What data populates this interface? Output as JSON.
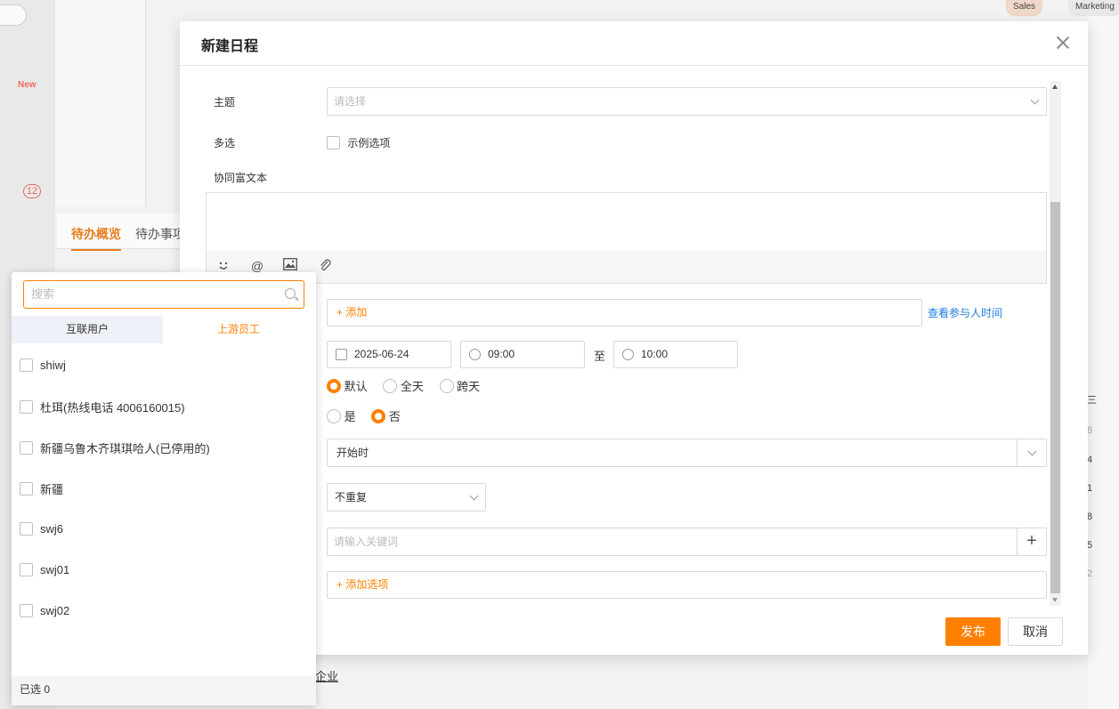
{
  "background": {
    "new_badge": "New",
    "count_badge": "12",
    "tab_active": "待办概览",
    "tab_other": "待办事项",
    "top_right_a": "Sales",
    "top_right_b": "Marketing",
    "enterprise_link": "企业",
    "side_numbers": [
      "三",
      "8",
      "4",
      "1",
      "8",
      "5",
      "2"
    ]
  },
  "modal": {
    "title": "新建日程",
    "subject": {
      "label": "主题",
      "placeholder": "请选择"
    },
    "multi": {
      "label": "多选",
      "option": "示例选项"
    },
    "richtext": {
      "label": "协同富文本"
    },
    "participants": {
      "add": "+ 添加",
      "view_time": "查看参与人时间"
    },
    "date": "2025-06-24",
    "start_time": "09:00",
    "to": "至",
    "end_time": "10:00",
    "day_options": [
      "默认",
      "全天",
      "跨天"
    ],
    "day_selected": 0,
    "yes_no": [
      "是",
      "否"
    ],
    "yes_no_selected": 1,
    "remind_select": "开始时",
    "repeat_select": "不重复",
    "keyword_placeholder": "请输入关键词",
    "add_option": "+ 添加选项",
    "publish": "发布",
    "cancel": "取消"
  },
  "picker": {
    "search_placeholder": "搜索",
    "tabs": [
      "互联用户",
      "上游员工"
    ],
    "active_tab": 1,
    "items": [
      "shiwj",
      "杜珥(热线电话 4006160015)",
      "新疆乌鲁木齐琪琪哈人(已停用的)",
      "新疆",
      "swj6",
      "swj01",
      "swj02"
    ],
    "selected_count": "已选 0"
  }
}
